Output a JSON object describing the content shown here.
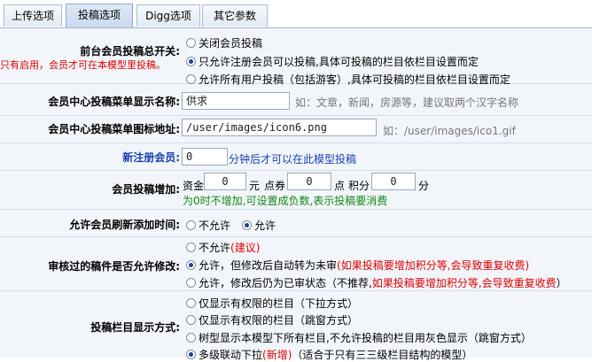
{
  "tabs": [
    "上传选项",
    "投稿选项",
    "Digg选项",
    "其它参数"
  ],
  "active_tab": 1,
  "master_switch": {
    "label": "前台会员投稿总开关:",
    "note": "只有启用，会员才可在本模型里投稿。",
    "options": [
      "关闭会员投稿",
      "只允许注册会员可以投稿,具体可投稿的栏目依栏目设置而定",
      "允许所有用户投稿（包括游客）,具体可投稿的栏目依栏目设置而定"
    ],
    "selected": 1
  },
  "menu_name": {
    "label": "会员中心投稿菜单显示名称:",
    "value": "供求",
    "hint": "如：文章，新闻，房源等，建议取两个汉字名称"
  },
  "menu_icon": {
    "label": "会员中心投稿菜单图标地址:",
    "value": "/user/images/icon6.png",
    "hint": "如：/user/images/ico1.gif"
  },
  "new_member": {
    "label": "新注册会员:",
    "value": "0",
    "suffix": "分钟后才可以在此模型投稿"
  },
  "reward": {
    "label": "会员投稿增加:",
    "funds_label": "资金",
    "funds_value": "0",
    "funds_unit": "元",
    "coupon_label": "点券",
    "coupon_value": "0",
    "coupon_unit": "点",
    "points_label": "积分",
    "points_value": "0",
    "points_unit": "分",
    "note": "为0时不增加,可设置成负数,表示投稿要消费"
  },
  "refresh": {
    "label": "允许会员刷新添加时间:",
    "options": [
      "不允许",
      "允许"
    ],
    "selected": 1
  },
  "modify": {
    "label": "审核过的稿件是否允许修改:",
    "opt1": "不允许",
    "opt1_note": "(建议)",
    "opt2": "允许，但修改后自动转为未审",
    "opt2_note": "(如果投稿要增加积分等,会导致重复收费)",
    "opt3": "允许，修改后仍为已审状态（不推荐,",
    "opt3_note": "如果投稿要增加积分等,会导致重复收费",
    "opt3_end": "）",
    "selected": 1
  },
  "column_display": {
    "label": "投稿栏目显示方式:",
    "opt1": "仅显示有权限的栏目（下拉方式）",
    "opt2": "仅显示有权限的栏目（跳窗方式）",
    "opt3": "树型显示本模型下所有栏目,不允许投稿的栏目用灰色显示（跳窗方式）",
    "opt4": "多级联动下拉",
    "opt4_note": "(新增)",
    "opt4_end": "（适合于只有三三级栏目结构的模型）",
    "selected": 3
  }
}
